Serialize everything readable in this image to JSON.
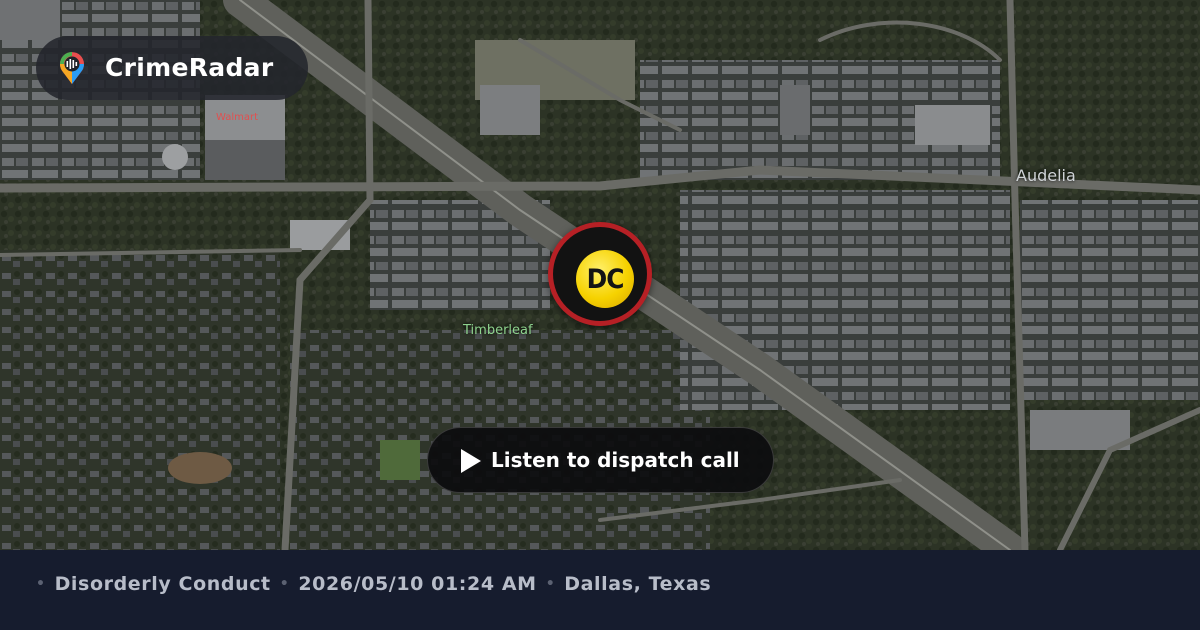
{
  "brand": {
    "name": "CrimeRadar",
    "icon": "crimeradar-pin-icon",
    "icon_colors": [
      "#f5a623",
      "#e94e4e",
      "#4caf50",
      "#2a9df4"
    ]
  },
  "map": {
    "labels": {
      "audelia": "Audelia",
      "timberleaf": "Timberleaf",
      "store": "Walmart"
    }
  },
  "marker": {
    "code": "DC",
    "ring_color": "#b62025",
    "badge_color": "#f6d200"
  },
  "listen_button": {
    "label": "Listen to dispatch call",
    "icon": "play-icon"
  },
  "footer": {
    "separator": "•",
    "incident_type": "Disorderly Conduct",
    "datetime": "2026/05/10 01:24 AM",
    "location": "Dallas, Texas"
  }
}
